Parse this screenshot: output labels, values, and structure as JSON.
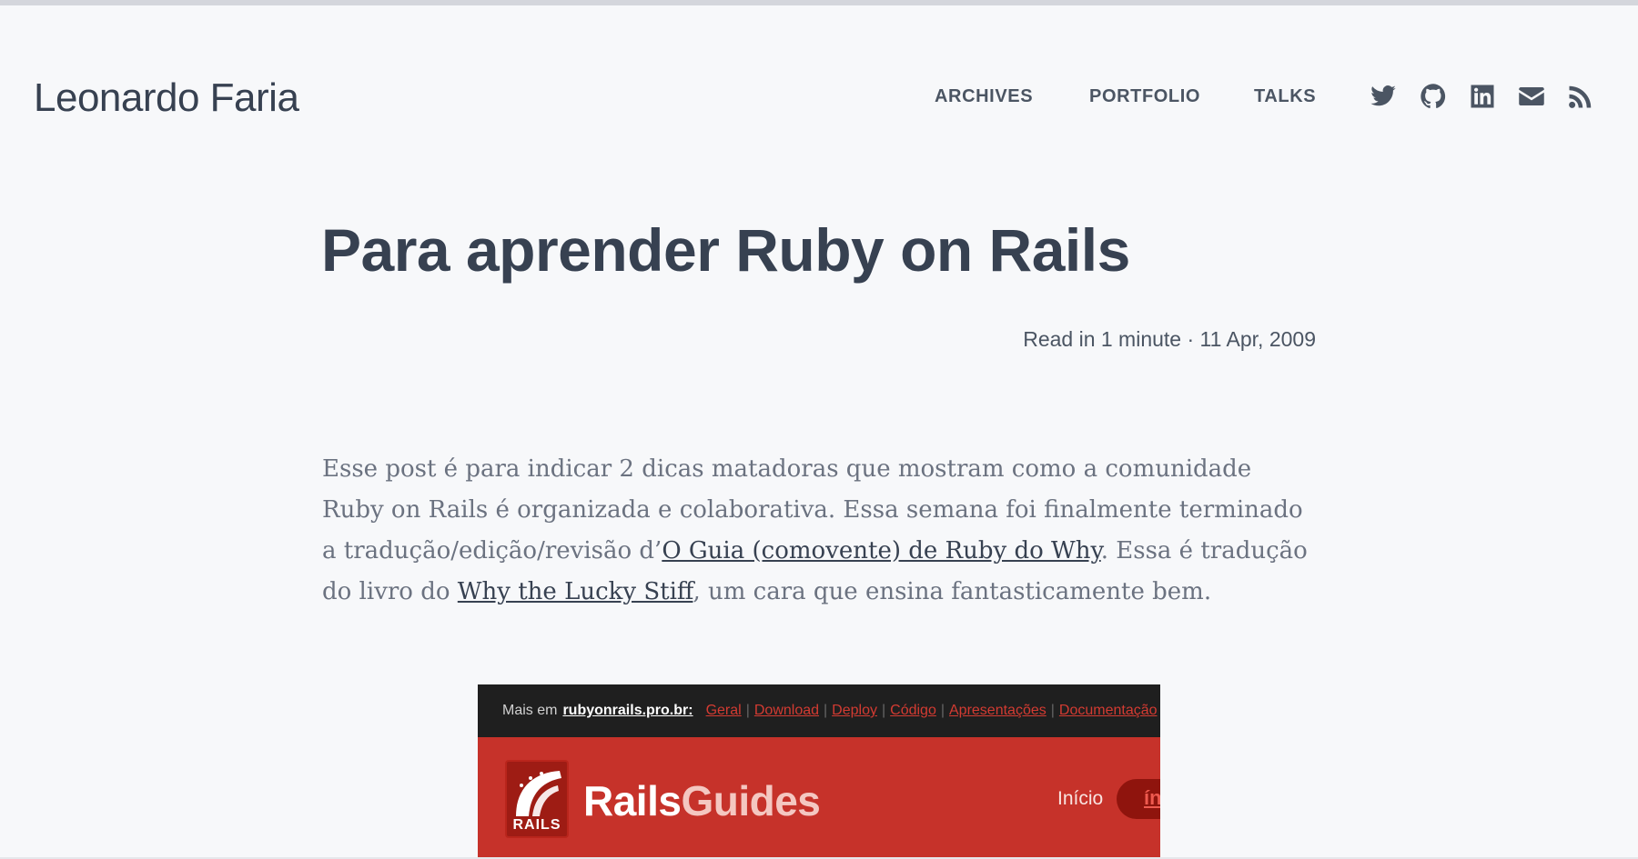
{
  "site": {
    "title": "Leonardo Faria"
  },
  "nav": {
    "archives": "ARCHIVES",
    "portfolio": "PORTFOLIO",
    "talks": "TALKS"
  },
  "social": [
    "twitter-icon",
    "github-icon",
    "linkedin-icon",
    "email-icon",
    "rss-icon"
  ],
  "post": {
    "title": "Para aprender Ruby on Rails",
    "meta": "Read in 1 minute · 11 Apr, 2009",
    "paragraph": {
      "t1": "Esse post é para indicar 2 dicas matadoras que mostram como a comunidade Ruby on Rails é organizada e colaborativa. Essa semana foi finalmente terminado a tradução/edição/revisão d’",
      "link1": "O Guia (comovente) de Ruby do Why",
      "t2": ". Essa é tradução do livro do ",
      "link2": "Why the Lucky Stiff",
      "t3": ", um cara que ensina fantasticamente bem."
    }
  },
  "screenshot": {
    "bar_lead": "Mais em",
    "bar_site": "rubyonrails.pro.br:",
    "bar_links": [
      "Geral",
      "Download",
      "Deploy",
      "Código",
      "Apresentações",
      "Documentação"
    ],
    "logo_word": "RAILS",
    "title_a": "Rails",
    "title_b": "Guides",
    "inicio": "Início",
    "pill": "ín"
  },
  "colors": {
    "accent": "#374151",
    "background": "#f7f8fa",
    "rails_red": "#c6322a"
  }
}
